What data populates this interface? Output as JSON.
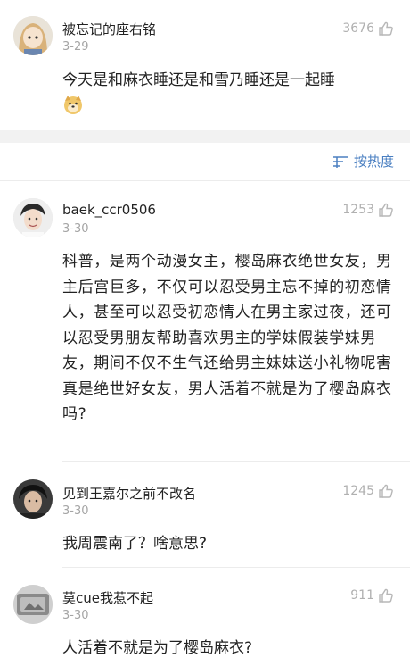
{
  "comments": [
    {
      "username": "被忘记的座右铭",
      "date": "3-29",
      "likes": "3676",
      "text": "今天是和麻衣睡还是和雪乃睡还是一起睡",
      "emoji": "doge-emoji"
    },
    {
      "username": "baek_ccr0506",
      "date": "3-30",
      "likes": "1253",
      "text": "科普，是两个动漫女主，樱岛麻衣绝世女友，男主后宫巨多，不仅可以忍受男主忘不掉的初恋情人，甚至可以忍受初恋情人在男主家过夜，还可以忍受男朋友帮助喜欢男主的学妹假装学妹男友，期间不仅不生气还给男主妹妹送小礼物呢害真是绝世好女友，男人活着不就是为了樱岛麻衣吗?"
    },
    {
      "username": "见到王嘉尔之前不改名",
      "date": "3-30",
      "likes": "1245",
      "text": "我周震南了？啥意思?"
    },
    {
      "username": "莫cue我惹不起",
      "date": "3-30",
      "likes": "911",
      "text": "人活着不就是为了樱岛麻衣?"
    }
  ],
  "sort": {
    "label": "按热度",
    "icon": "sort-icon"
  },
  "colors": {
    "accent": "#4a7fc1",
    "meta": "#a5a5a5",
    "separator": "#f2f2f2"
  }
}
